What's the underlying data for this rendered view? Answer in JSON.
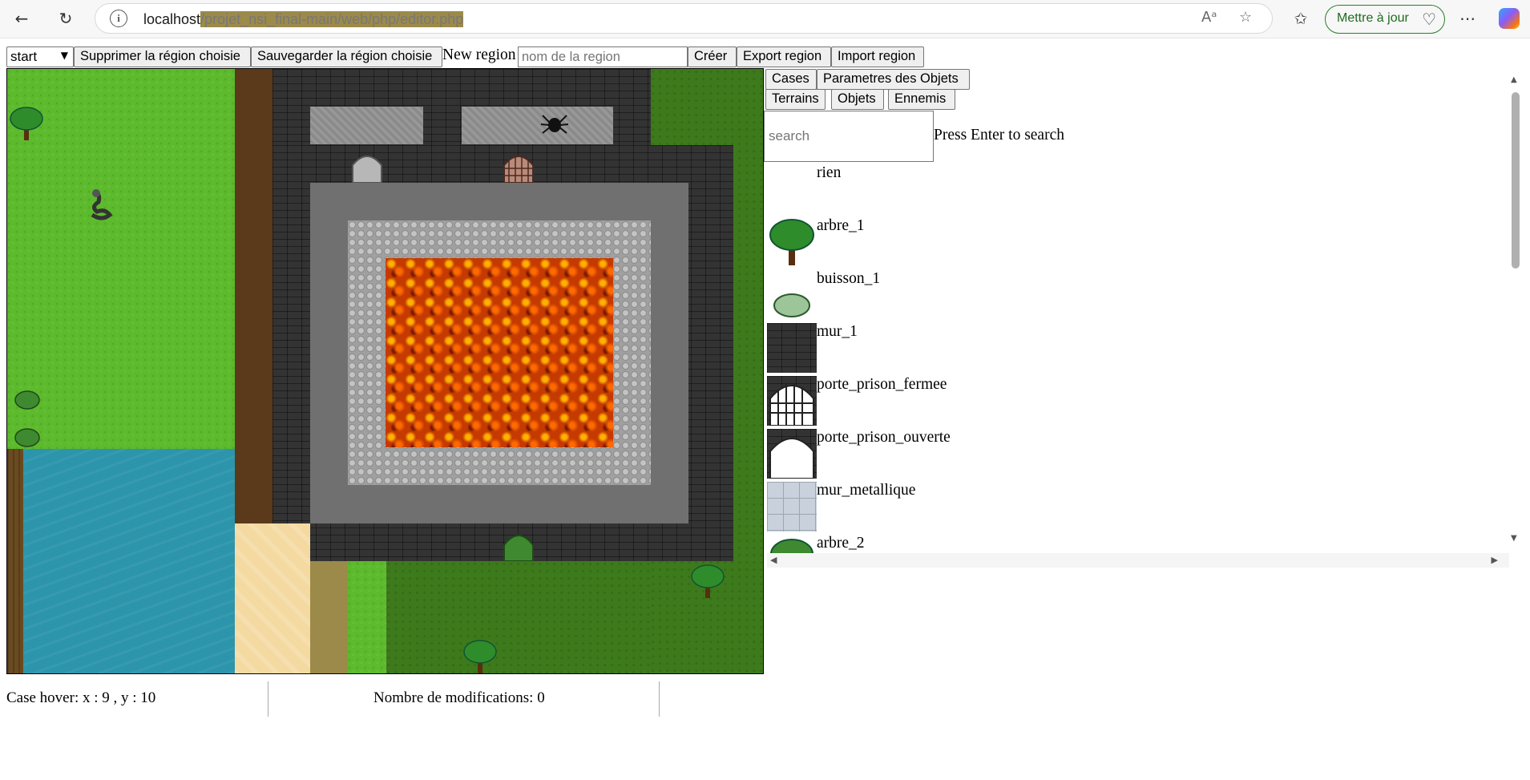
{
  "browser": {
    "url_host": "localhost",
    "url_path": "/projet_nsi_final-main/web/php/editor.php",
    "update_label": "Mettre à jour",
    "icons": {
      "back": "back-arrow-icon",
      "reload": "reload-icon",
      "info": "info-icon",
      "read_aloud": "read-aloud-icon",
      "favorite": "star-icon",
      "favorites_list": "favorites-icon",
      "menu": "more-icon",
      "copilot": "copilot-icon"
    }
  },
  "toolbar": {
    "region_selected": "start",
    "delete_label": "Supprimer la région choisie",
    "save_label": "Sauvegarder la région choisie",
    "new_region_label": "New region",
    "region_placeholder": "nom de la region",
    "create_label": "Créer",
    "export_label": "Export region",
    "import_label": "Import region"
  },
  "panel": {
    "tabs_top": [
      "Cases",
      "Parametres des Objets"
    ],
    "tabs": [
      "Terrains",
      "Objets",
      "Ennemis"
    ],
    "search_placeholder": "search",
    "search_hint": "Press Enter to search",
    "items": [
      {
        "name": "rien"
      },
      {
        "name": "arbre_1"
      },
      {
        "name": "buisson_1"
      },
      {
        "name": "mur_1"
      },
      {
        "name": "porte_prison_fermee"
      },
      {
        "name": "porte_prison_ouverte"
      },
      {
        "name": "mur_metallique"
      },
      {
        "name": "arbre_2"
      }
    ]
  },
  "status": {
    "hover": "Case hover: x : 9 , y : 10",
    "modifications": "Nombre de modifications: 0"
  },
  "colors": {
    "grass": "#5cba2c",
    "dark_grass": "#3d7a1c",
    "water": "#2c95ab",
    "wall": "#333333",
    "lava": "#c53a00",
    "update_border": "#2a7d2a"
  }
}
